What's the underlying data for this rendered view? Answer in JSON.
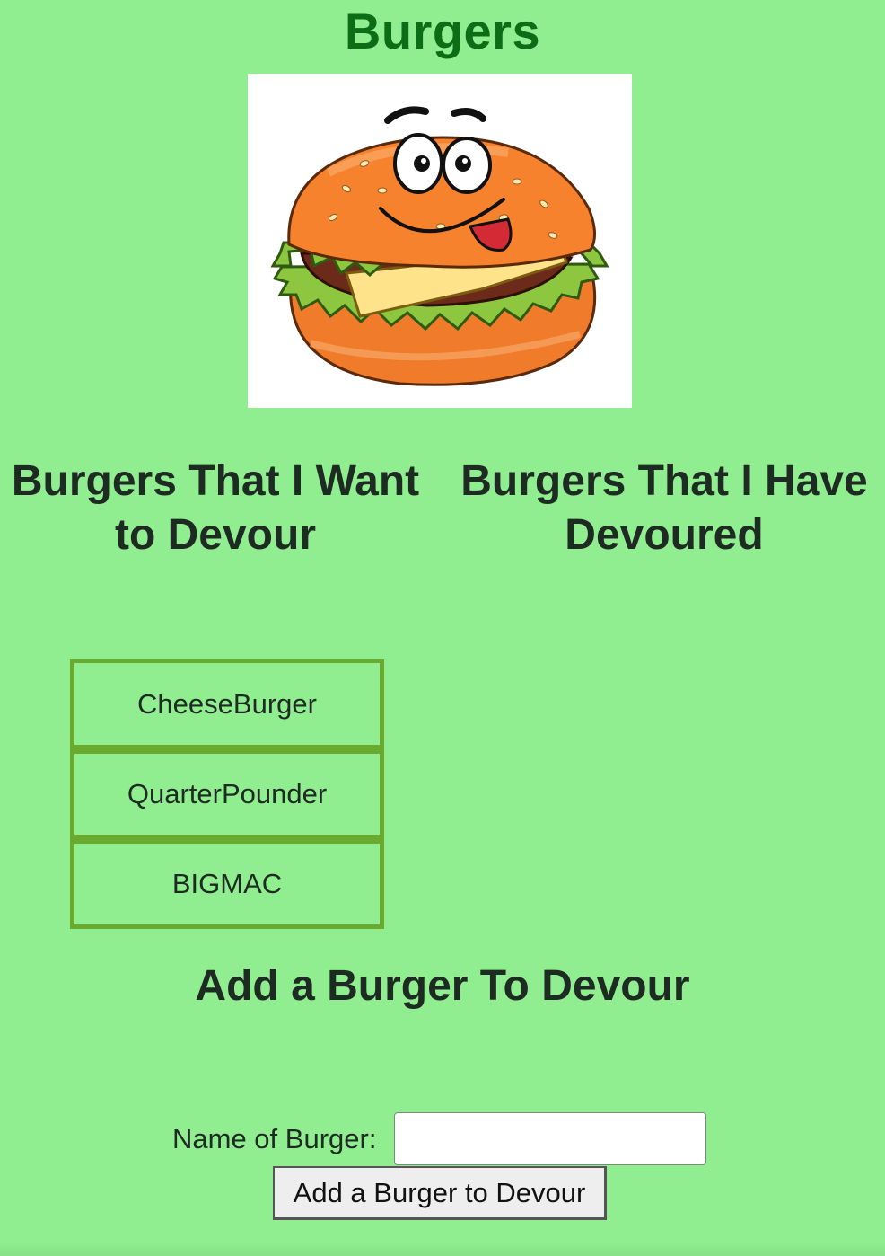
{
  "header": {
    "title": "Burgers"
  },
  "hero": {
    "icon": "cartoon-burger-image"
  },
  "columns": {
    "to_devour_heading": "Burgers That I Want to Devour",
    "devoured_heading": "Burgers That I Have Devoured"
  },
  "to_devour_list": [
    {
      "name": "CheeseBurger"
    },
    {
      "name": "QuarterPounder"
    },
    {
      "name": "BIGMAC"
    }
  ],
  "devoured_list": [],
  "add_form": {
    "heading": "Add a Burger To Devour",
    "name_label": "Name of Burger:",
    "name_value": "",
    "submit_label": "Add a Burger to Devour"
  },
  "colors": {
    "background": "#90ee90",
    "title": "#0b6d16",
    "item_border": "#6aaa2e"
  }
}
